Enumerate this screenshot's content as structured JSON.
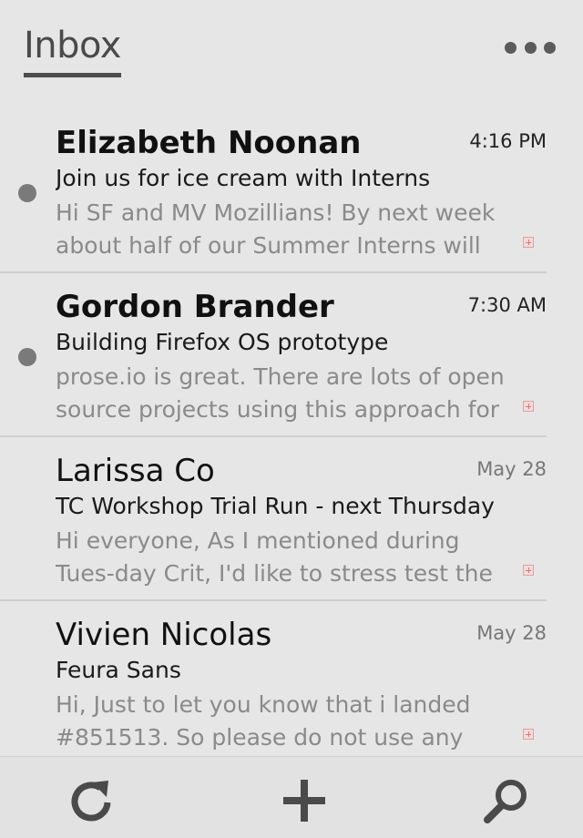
{
  "header": {
    "title": "Inbox",
    "menu_icon": "more-dots-icon"
  },
  "messages": [
    {
      "sender": "Elizabeth Noonan",
      "time": "4:16 PM",
      "subject": "Join us for ice cream with Interns",
      "snippet": "Hi SF and MV Mozillians! By next week about half of our Summer Interns will",
      "unread": true
    },
    {
      "sender": "Gordon Brander",
      "time": "7:30 AM",
      "subject": "Building Firefox OS prototype",
      "snippet": "prose.io is great. There are lots of open source projects using this approach for",
      "unread": true
    },
    {
      "sender": "Larissa Co",
      "time": "May 28",
      "subject": "TC Workshop Trial Run - next Thursday",
      "snippet": "Hi everyone, As I mentioned during Tues-day Crit, I'd like to stress test the Google",
      "unread": false
    },
    {
      "sender": "Vivien Nicolas",
      "time": "May 28",
      "subject": "Feura Sans",
      "snippet": "Hi, Just to let you know that i landed #851513. So please do not use any refer-",
      "unread": false
    }
  ],
  "toolbar": {
    "refresh_icon": "refresh-icon",
    "compose_icon": "add-icon",
    "search_icon": "search-icon"
  },
  "colors": {
    "background": "#e6e6e6",
    "text_primary": "#111111",
    "text_secondary": "#8a8a8a",
    "unread_dot": "#7a7a7a",
    "icon": "#4a4a4a"
  }
}
